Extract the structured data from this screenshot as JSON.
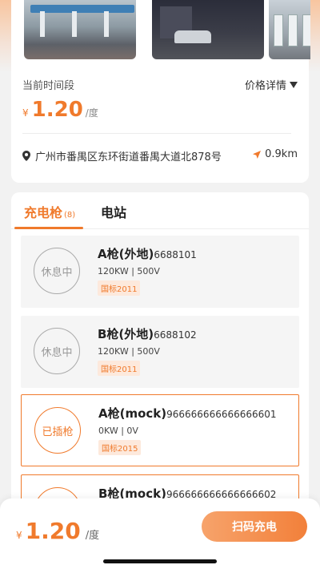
{
  "station": {
    "period_label": "当前时间段",
    "price_detail_label": "价格详情",
    "price_currency": "¥",
    "price_value": "1.20",
    "price_unit": "/度",
    "address": "广州市番禺区东环街道番禺大道北878号",
    "distance": "0.9km"
  },
  "tabs": {
    "guns_label": "充电枪",
    "guns_count": "(8)",
    "station_label": "电站"
  },
  "guns": [
    {
      "status": "休息中",
      "name": "A枪(外地)",
      "code": "6688101",
      "spec": "120KW | 500V",
      "standard": "国标2011",
      "active": false
    },
    {
      "status": "休息中",
      "name": "B枪(外地)",
      "code": "6688102",
      "spec": "120KW | 500V",
      "standard": "国标2011",
      "active": false
    },
    {
      "status": "已插枪",
      "name": "A枪(mock)",
      "code": "966666666666666601",
      "spec": "0KW | 0V",
      "standard": "国标2015",
      "active": true
    },
    {
      "status": "",
      "name": "B枪(mock)",
      "code": "966666666666666602",
      "spec": "",
      "standard": "",
      "active": true
    }
  ],
  "bottom_bar": {
    "currency": "¥",
    "price": "1.20",
    "unit": "/度",
    "scan_button_label": "扫码充电"
  },
  "colors": {
    "accent": "#f07a2c",
    "badge_bg": "#fde9dc"
  }
}
